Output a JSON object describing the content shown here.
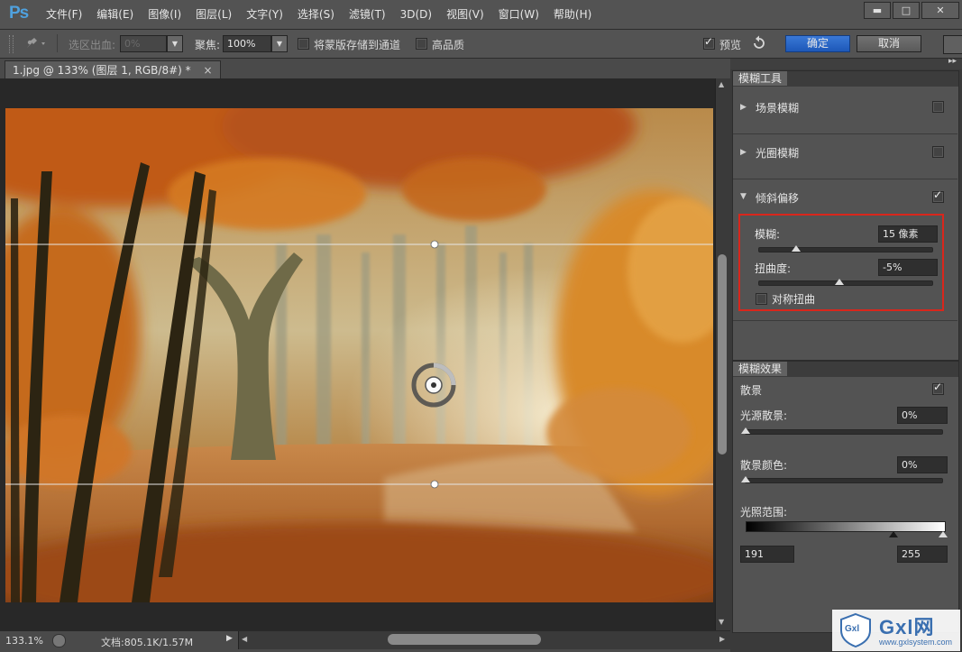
{
  "app": {
    "logo": "Ps",
    "menus": [
      "文件(F)",
      "编辑(E)",
      "图像(I)",
      "图层(L)",
      "文字(Y)",
      "选择(S)",
      "滤镜(T)",
      "3D(D)",
      "视图(V)",
      "窗口(W)",
      "帮助(H)"
    ],
    "window_controls": {
      "minimize": "▬",
      "maximize": "□",
      "close": "✕"
    }
  },
  "options": {
    "selection_bleed_label": "选区出血:",
    "selection_bleed_value": "0%",
    "focus_label": "聚焦:",
    "focus_value": "100%",
    "save_mask_label": "将蒙版存储到通道",
    "high_quality_label": "高品质",
    "preview_label": "预览",
    "ok_label": "确定",
    "cancel_label": "取消",
    "save_mask_checked": false,
    "high_quality_checked": false,
    "preview_checked": true
  },
  "document": {
    "tab_title": "1.jpg @ 133% (图层 1, RGB/8#) *",
    "tab_close": "×",
    "zoom": "133.1%",
    "doc_info": "文档:805.1K/1.57M"
  },
  "blur_tools": {
    "panel_title": "模糊工具",
    "field_blur": {
      "label": "场景模糊",
      "checked": false
    },
    "iris_blur": {
      "label": "光圈模糊",
      "checked": false
    },
    "tilt_shift": {
      "label": "倾斜偏移",
      "checked": true,
      "blur_label": "模糊:",
      "blur_value": "15 像素",
      "blur_fraction": 0.22,
      "distortion_label": "扭曲度:",
      "distortion_value": "-5%",
      "distortion_fraction": 0.47,
      "symmetric_label": "对称扭曲",
      "symmetric_checked": false
    }
  },
  "blur_effects": {
    "panel_title": "模糊效果",
    "bokeh_label": "散景",
    "bokeh_checked": true,
    "light_bokeh_label": "光源散景:",
    "light_bokeh_value": "0%",
    "bokeh_color_label": "散景颜色:",
    "bokeh_color_value": "0%",
    "light_range_label": "光照范围:",
    "light_range_low": "191",
    "light_range_high": "255"
  },
  "watermark": {
    "logo_text": "Gxl",
    "brand": "Gxl网",
    "url": "www.gxlsystem.com"
  },
  "colors": {
    "ui_bg": "#535353",
    "accent_blue": "#1d58b8",
    "highlight_red": "#d9261c",
    "logo_blue": "#4fa1de"
  }
}
